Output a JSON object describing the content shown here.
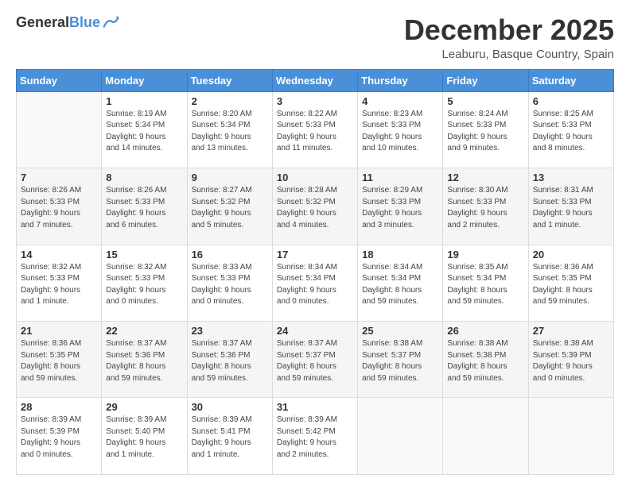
{
  "header": {
    "logo_general": "General",
    "logo_blue": "Blue",
    "month_title": "December 2025",
    "location": "Leaburu, Basque Country, Spain"
  },
  "weekdays": [
    "Sunday",
    "Monday",
    "Tuesday",
    "Wednesday",
    "Thursday",
    "Friday",
    "Saturday"
  ],
  "rows": [
    [
      {
        "day": "",
        "info": ""
      },
      {
        "day": "1",
        "info": "Sunrise: 8:19 AM\nSunset: 5:34 PM\nDaylight: 9 hours\nand 14 minutes."
      },
      {
        "day": "2",
        "info": "Sunrise: 8:20 AM\nSunset: 5:34 PM\nDaylight: 9 hours\nand 13 minutes."
      },
      {
        "day": "3",
        "info": "Sunrise: 8:22 AM\nSunset: 5:33 PM\nDaylight: 9 hours\nand 11 minutes."
      },
      {
        "day": "4",
        "info": "Sunrise: 8:23 AM\nSunset: 5:33 PM\nDaylight: 9 hours\nand 10 minutes."
      },
      {
        "day": "5",
        "info": "Sunrise: 8:24 AM\nSunset: 5:33 PM\nDaylight: 9 hours\nand 9 minutes."
      },
      {
        "day": "6",
        "info": "Sunrise: 8:25 AM\nSunset: 5:33 PM\nDaylight: 9 hours\nand 8 minutes."
      }
    ],
    [
      {
        "day": "7",
        "info": "Sunrise: 8:26 AM\nSunset: 5:33 PM\nDaylight: 9 hours\nand 7 minutes."
      },
      {
        "day": "8",
        "info": "Sunrise: 8:26 AM\nSunset: 5:33 PM\nDaylight: 9 hours\nand 6 minutes."
      },
      {
        "day": "9",
        "info": "Sunrise: 8:27 AM\nSunset: 5:32 PM\nDaylight: 9 hours\nand 5 minutes."
      },
      {
        "day": "10",
        "info": "Sunrise: 8:28 AM\nSunset: 5:32 PM\nDaylight: 9 hours\nand 4 minutes."
      },
      {
        "day": "11",
        "info": "Sunrise: 8:29 AM\nSunset: 5:33 PM\nDaylight: 9 hours\nand 3 minutes."
      },
      {
        "day": "12",
        "info": "Sunrise: 8:30 AM\nSunset: 5:33 PM\nDaylight: 9 hours\nand 2 minutes."
      },
      {
        "day": "13",
        "info": "Sunrise: 8:31 AM\nSunset: 5:33 PM\nDaylight: 9 hours\nand 1 minute."
      }
    ],
    [
      {
        "day": "14",
        "info": "Sunrise: 8:32 AM\nSunset: 5:33 PM\nDaylight: 9 hours\nand 1 minute."
      },
      {
        "day": "15",
        "info": "Sunrise: 8:32 AM\nSunset: 5:33 PM\nDaylight: 9 hours\nand 0 minutes."
      },
      {
        "day": "16",
        "info": "Sunrise: 8:33 AM\nSunset: 5:33 PM\nDaylight: 9 hours\nand 0 minutes."
      },
      {
        "day": "17",
        "info": "Sunrise: 8:34 AM\nSunset: 5:34 PM\nDaylight: 9 hours\nand 0 minutes."
      },
      {
        "day": "18",
        "info": "Sunrise: 8:34 AM\nSunset: 5:34 PM\nDaylight: 8 hours\nand 59 minutes."
      },
      {
        "day": "19",
        "info": "Sunrise: 8:35 AM\nSunset: 5:34 PM\nDaylight: 8 hours\nand 59 minutes."
      },
      {
        "day": "20",
        "info": "Sunrise: 8:36 AM\nSunset: 5:35 PM\nDaylight: 8 hours\nand 59 minutes."
      }
    ],
    [
      {
        "day": "21",
        "info": "Sunrise: 8:36 AM\nSunset: 5:35 PM\nDaylight: 8 hours\nand 59 minutes."
      },
      {
        "day": "22",
        "info": "Sunrise: 8:37 AM\nSunset: 5:36 PM\nDaylight: 8 hours\nand 59 minutes."
      },
      {
        "day": "23",
        "info": "Sunrise: 8:37 AM\nSunset: 5:36 PM\nDaylight: 8 hours\nand 59 minutes."
      },
      {
        "day": "24",
        "info": "Sunrise: 8:37 AM\nSunset: 5:37 PM\nDaylight: 8 hours\nand 59 minutes."
      },
      {
        "day": "25",
        "info": "Sunrise: 8:38 AM\nSunset: 5:37 PM\nDaylight: 8 hours\nand 59 minutes."
      },
      {
        "day": "26",
        "info": "Sunrise: 8:38 AM\nSunset: 5:38 PM\nDaylight: 8 hours\nand 59 minutes."
      },
      {
        "day": "27",
        "info": "Sunrise: 8:38 AM\nSunset: 5:39 PM\nDaylight: 9 hours\nand 0 minutes."
      }
    ],
    [
      {
        "day": "28",
        "info": "Sunrise: 8:39 AM\nSunset: 5:39 PM\nDaylight: 9 hours\nand 0 minutes."
      },
      {
        "day": "29",
        "info": "Sunrise: 8:39 AM\nSunset: 5:40 PM\nDaylight: 9 hours\nand 1 minute."
      },
      {
        "day": "30",
        "info": "Sunrise: 8:39 AM\nSunset: 5:41 PM\nDaylight: 9 hours\nand 1 minute."
      },
      {
        "day": "31",
        "info": "Sunrise: 8:39 AM\nSunset: 5:42 PM\nDaylight: 9 hours\nand 2 minutes."
      },
      {
        "day": "",
        "info": ""
      },
      {
        "day": "",
        "info": ""
      },
      {
        "day": "",
        "info": ""
      }
    ]
  ]
}
